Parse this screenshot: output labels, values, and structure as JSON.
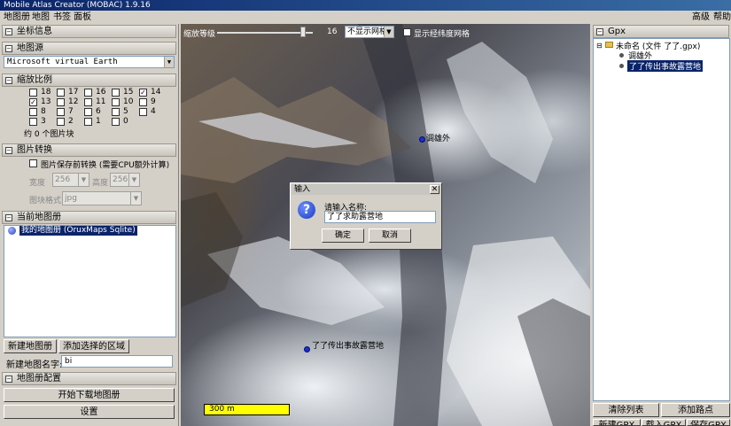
{
  "window": {
    "title": "Mobile Atlas Creator (MOBAC) 1.9.16"
  },
  "menu": {
    "items": [
      "地图册",
      "地图",
      "书签",
      "面板"
    ],
    "right_items": [
      "高级",
      "帮助"
    ]
  },
  "left": {
    "coords_header": "坐标信息",
    "map_source": {
      "header": "地图源",
      "selected": "Microsoft virtual Earth"
    },
    "zoom": {
      "header": "缩放比例",
      "levels": [
        "18",
        "17",
        "16",
        "15",
        "14",
        "13",
        "12",
        "11",
        "10",
        "9",
        "8",
        "7",
        "6",
        "5",
        "4",
        "3",
        "2",
        "1",
        "0"
      ],
      "checked": [
        "14",
        "13"
      ],
      "tile_count": "约 0 个图片块"
    },
    "convert": {
      "header": "图片转换",
      "option_label": "图片保存前转换 (需要CPU额外计算)",
      "width_label": "宽度",
      "width_value": "256",
      "height_label": "高度",
      "height_value": "256",
      "format_label": "图块格式",
      "format_value": "jpg"
    },
    "atlas": {
      "header": "当前地图册",
      "item": "我的地图册 (OruxMaps Sqlite)",
      "new_button": "新建地图册",
      "add_button": "添加选择的区域",
      "name_label": "新建地图名字:",
      "name_value": "bi"
    },
    "config": {
      "header": "地图册配置",
      "start_button": "开始下载地图册",
      "settings_button": "设置"
    }
  },
  "map": {
    "zoom_label": "缩放等级",
    "zoom_value": "16",
    "zoom_fraction": 0.9,
    "grid_select": "不显示网格",
    "latlon_grid_label": "显示经纬度网格",
    "waypoints": [
      {
        "label": "调雄外"
      },
      {
        "label": "了了传出事故露营地"
      }
    ],
    "scale_label": "300 m"
  },
  "gpx": {
    "header": "Gpx",
    "tree_root": "未命名 (文件 了了.gpx)",
    "tree_items": [
      "调雄外",
      "了了传出事故露营地"
    ],
    "clear_button": "清除列表",
    "add_point_button": "添加路点",
    "new_button": "新建GPX",
    "load_button": "载入GPX",
    "save_button": "保存GPX"
  },
  "dialog": {
    "title": "输入",
    "prompt": "请输入名称:",
    "value": "了了求助露营地",
    "ok": "确定",
    "cancel": "取消"
  },
  "colors": {
    "title_start": "#0a246a",
    "title_end": "#3a6ea5",
    "scale_bar": "#ffff00",
    "selection": "#0a246a"
  }
}
